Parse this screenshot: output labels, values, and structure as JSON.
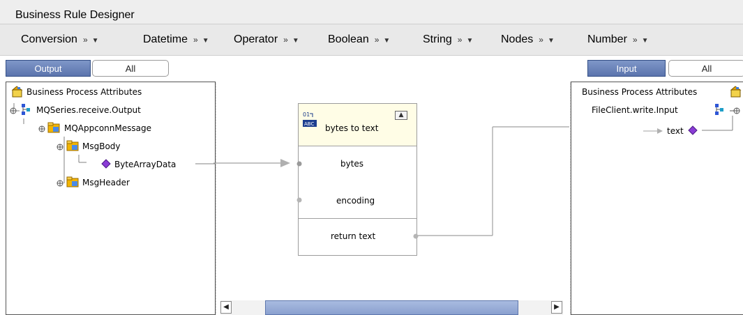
{
  "window": {
    "title": "Business Rule Designer"
  },
  "menubar": {
    "items": [
      {
        "label": "Conversion",
        "chev": "»",
        "tri": "▼"
      },
      {
        "label": "Datetime",
        "chev": "»",
        "tri": "▼"
      },
      {
        "label": "Operator",
        "chev": "»",
        "tri": "▼"
      },
      {
        "label": "Boolean",
        "chev": "»",
        "tri": "▼"
      },
      {
        "label": "String",
        "chev": "»",
        "tri": "▼"
      },
      {
        "label": "Nodes",
        "chev": "»",
        "tri": "▼"
      },
      {
        "label": "Number",
        "chev": "»",
        "tri": "▼"
      }
    ]
  },
  "left_panel": {
    "tabs": {
      "active": "Output",
      "other": "All"
    },
    "tree": {
      "root": "Business Process Attributes",
      "node1": "MQSeries.receive.Output",
      "node2": "MQAppconnMessage",
      "node3": "MsgBody",
      "leaf": "ByteArrayData",
      "node4": "MsgHeader"
    }
  },
  "right_panel": {
    "tabs": {
      "active": "Input",
      "other": "All"
    },
    "tree": {
      "root": "Business Process Attributes",
      "node1": "FileClient.write.Input",
      "leaf": "text"
    }
  },
  "function_box": {
    "title": "bytes to text",
    "icon_label": "ABC",
    "inputs": [
      "bytes",
      "encoding"
    ],
    "output": "return text"
  },
  "colors": {
    "tab_active": "#5b74ad",
    "link_line": "#a0a0a0",
    "diamond": "#8a3cd6",
    "folder": "#f2b400"
  }
}
